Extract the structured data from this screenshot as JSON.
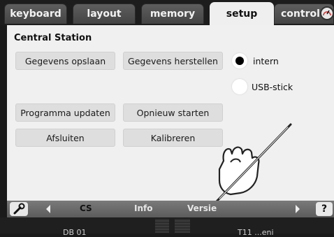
{
  "tabs": {
    "keyboard": "keyboard",
    "layout": "layout",
    "memory": "memory",
    "setup": "setup",
    "control": "control",
    "active": "setup"
  },
  "panel": {
    "title": "Central Station",
    "buttons": {
      "save": "Gegevens opslaan",
      "restore": "Gegevens herstellen",
      "update": "Programma updaten",
      "restart": "Opnieuw starten",
      "quit": "Afsluiten",
      "calibrate": "Kalibreren"
    },
    "storage": {
      "options": [
        {
          "label": "intern",
          "checked": true
        },
        {
          "label": "USB-stick",
          "checked": false
        }
      ]
    }
  },
  "bottom_bar": {
    "items": [
      "CS",
      "Info",
      "Versie"
    ],
    "help": "?",
    "active_item": "CS"
  },
  "status": {
    "left": "DB 01",
    "right": "T11 ...eni"
  },
  "colors": {
    "panel_bg": "#f0f0f0",
    "button_bg": "#dedede",
    "tab_bg": "#4e4e4e",
    "tab_active_bg": "#efefef",
    "bottom_bar_bg": "#6b6b6b"
  },
  "icons": [
    "gauge-icon",
    "wrench-icon",
    "arrow-left-icon",
    "arrow-right-icon",
    "help-icon",
    "pen-hand-icon"
  ]
}
